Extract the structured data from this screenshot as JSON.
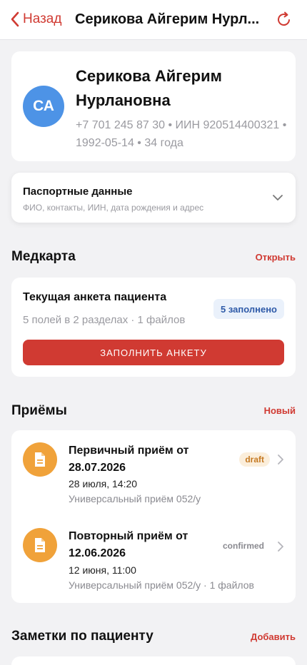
{
  "nav": {
    "back_label": "Назад",
    "title": "Серикова Айгерим Нурл..."
  },
  "profile": {
    "initials": "СА",
    "name": "Серикова Айгерим Нурлановна",
    "meta": "+7 701 245 87 30 • ИИН 920514400321 • 1992-05-14 • 34 года"
  },
  "passport": {
    "title": "Паспортные данные",
    "subtitle": "ФИО, контакты, ИИН, дата рождения и адрес"
  },
  "medcard": {
    "section_title": "Медкарта",
    "open_link": "Открыть",
    "form_title": "Текущая анкета пациента",
    "form_sub": "5 полей в 2 разделах · 1 файлов",
    "badge": "5 заполнено",
    "button": "ЗАПОЛНИТЬ АНКЕТУ"
  },
  "appointments": {
    "section_title": "Приёмы",
    "new_link": "Новый",
    "items": [
      {
        "title": "Первичный приём от 28.07.2026",
        "date": "28 июля, 14:20",
        "meta": "Универсальный приём 052/у",
        "status": "draft"
      },
      {
        "title": "Повторный приём от 12.06.2026",
        "date": "12 июня, 11:00",
        "meta": "Универсальный приём 052/у · 1 файлов",
        "status": "confirmed"
      }
    ]
  },
  "notes": {
    "section_title": "Заметки по пациенту",
    "add_link": "Добавить"
  },
  "colors": {
    "accent": "#d03a32",
    "avatar": "#4d93e6",
    "appointment_icon": "#f0a23a",
    "badge_blue_bg": "#eaf1fb",
    "draft_bg": "#fbeedb"
  },
  "icons": {
    "back": "chevron-left-icon",
    "refresh": "refresh-icon",
    "expand": "chevron-down-icon",
    "appointment": "document-icon",
    "open": "chevron-right-icon"
  }
}
